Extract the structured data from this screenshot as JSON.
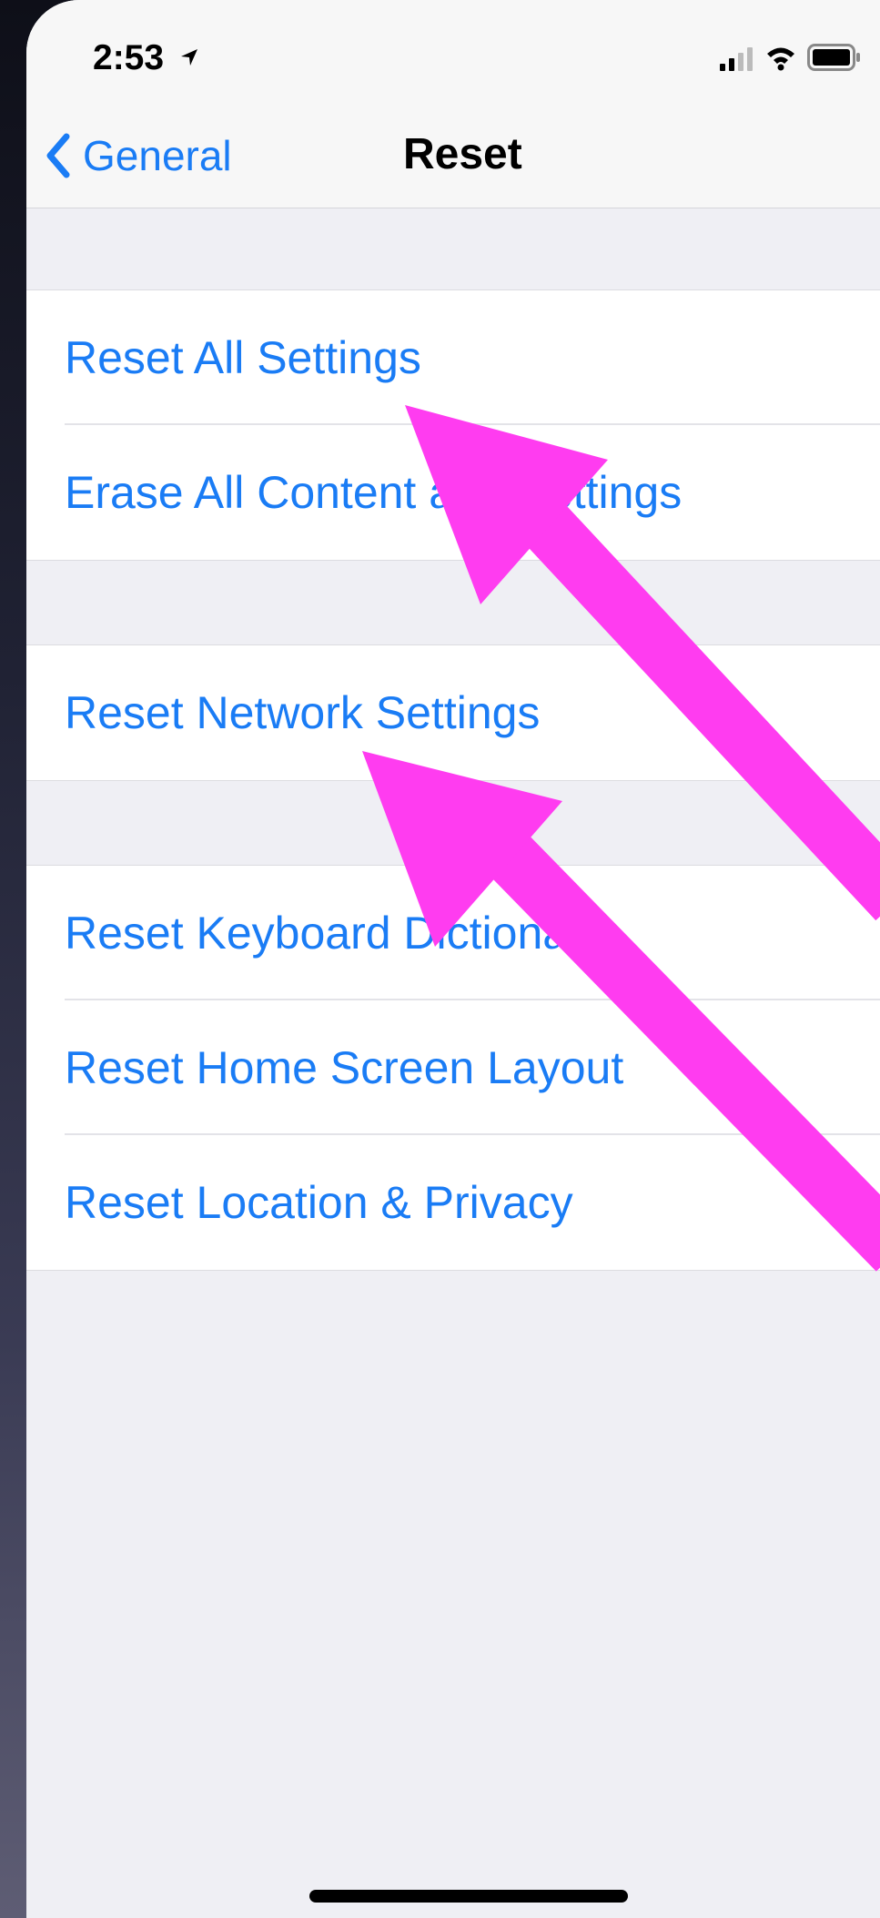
{
  "status_bar": {
    "time": "2:53",
    "icons": [
      "location-arrow-icon",
      "signal-icon",
      "wifi-icon",
      "battery-icon"
    ]
  },
  "nav": {
    "back_label": "General",
    "title": "Reset"
  },
  "groups": [
    {
      "items": [
        {
          "label": "Reset All Settings"
        },
        {
          "label": "Erase All Content and Settings"
        }
      ]
    },
    {
      "items": [
        {
          "label": "Reset Network Settings"
        }
      ]
    },
    {
      "items": [
        {
          "label": "Reset Keyboard Dictionary"
        },
        {
          "label": "Reset Home Screen Layout"
        },
        {
          "label": "Reset Location & Privacy"
        }
      ]
    }
  ],
  "colors": {
    "accent": "#1a7cf5",
    "background": "#efeff4",
    "annotation_arrow": "#ff3cf0"
  }
}
